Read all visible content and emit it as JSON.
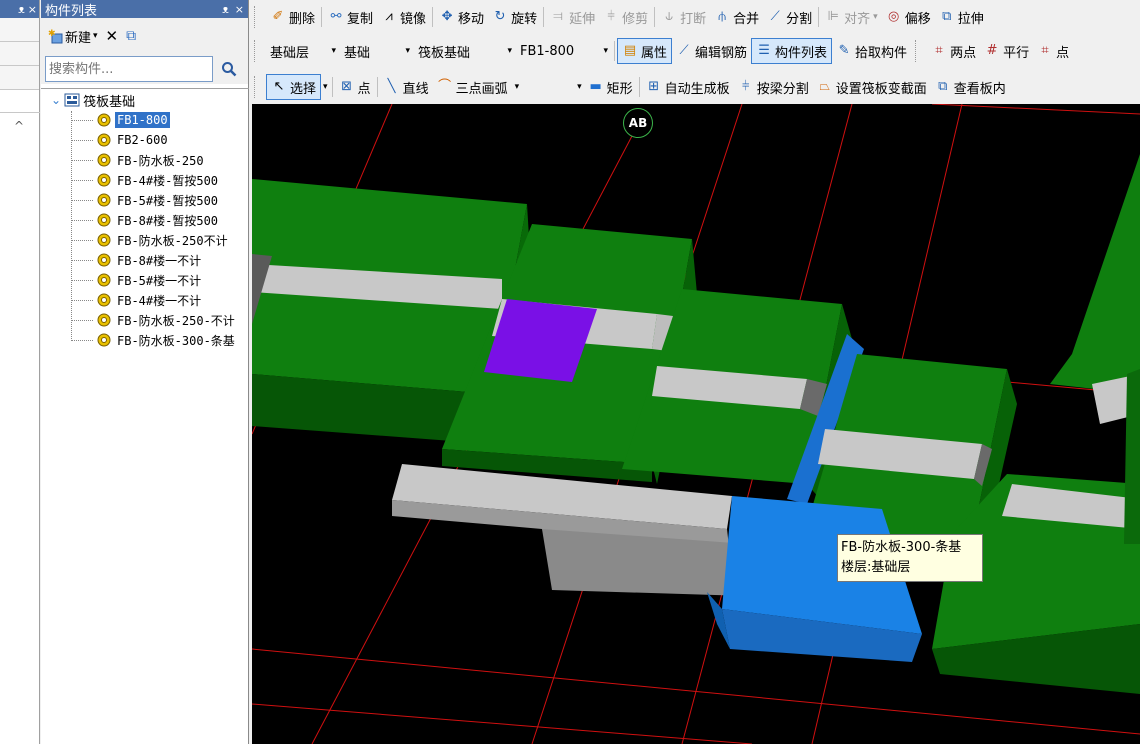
{
  "left_strip": {
    "pin_glyph": "ᴥ",
    "close_glyph": "×",
    "scroll_up_glyph": "^"
  },
  "component_list": {
    "title": "构件列表",
    "pin_glyph": "ᴥ",
    "close_glyph": "×",
    "toolbar": {
      "new_label": "新建",
      "new_arrow": "▾",
      "delete_glyph": "✕",
      "copy_glyph": "⧉"
    },
    "search": {
      "placeholder": "搜索构件...",
      "value": ""
    },
    "tree": {
      "root_expander": "⌄",
      "root_label": "筏板基础",
      "items": [
        {
          "label": "FB1-800",
          "selected": true
        },
        {
          "label": "FB2-600",
          "selected": false
        },
        {
          "label": "FB-防水板-250",
          "selected": false
        },
        {
          "label": "FB-4#楼-暂按500",
          "selected": false
        },
        {
          "label": "FB-5#楼-暂按500",
          "selected": false
        },
        {
          "label": "FB-8#楼-暂按500",
          "selected": false
        },
        {
          "label": "FB-防水板-250不计",
          "selected": false
        },
        {
          "label": "FB-8#楼一不计",
          "selected": false
        },
        {
          "label": "FB-5#楼一不计",
          "selected": false
        },
        {
          "label": "FB-4#楼一不计",
          "selected": false
        },
        {
          "label": "FB-防水板-250-不计",
          "selected": false
        },
        {
          "label": "FB-防水板-300-条基",
          "selected": false
        }
      ]
    }
  },
  "toolbar_row1": {
    "delete": "删除",
    "copy": "复制",
    "mirror": "镜像",
    "move": "移动",
    "rotate": "旋转",
    "extend": "延伸",
    "trim": "修剪",
    "break": "打断",
    "merge": "合并",
    "split": "分割",
    "align": "对齐",
    "align_arrow": "▾",
    "offset": "偏移",
    "stretch": "拉伸"
  },
  "toolbar_row2": {
    "floor_combo": "基础层",
    "floor_arrow": "▾",
    "category_combo": "基础",
    "type_arrow": "▾",
    "type_combo": "筏板基础",
    "type_arrow2": "▾",
    "component_combo": "FB1-800",
    "component_arrow": "▾",
    "properties": "属性",
    "edit_rebar": "编辑钢筋",
    "component_list": "构件列表",
    "pick_component": "拾取构件",
    "two_points": "两点",
    "parallel": "平行",
    "point_angle": "点"
  },
  "toolbar_row3": {
    "select": "选择",
    "select_arrow": "▾",
    "point": "点",
    "line": "直线",
    "arc": "三点画弧",
    "arc_arrow": "▾",
    "shape_arrow": "▾",
    "rect": "矩形",
    "auto_generate": "自动生成板",
    "split_by_beam": "按梁分割",
    "set_slope": "设置筏板变截面",
    "view_slab": "查看板内"
  },
  "viewport": {
    "axis_label": "AB",
    "tooltip_line1": "FB-防水板-300-条基",
    "tooltip_line2": "楼层:基础层"
  },
  "colors": {
    "title_bar": "#4a6fa8",
    "selection": "#3072c8",
    "slab_green": "#0e7d0e",
    "slab_dark_green": "#075707",
    "beam_gray": "#c4c4c4",
    "purple_slab": "#7a10e6",
    "blue_slab": "#1a82e6",
    "axis_red": "#d01010"
  }
}
